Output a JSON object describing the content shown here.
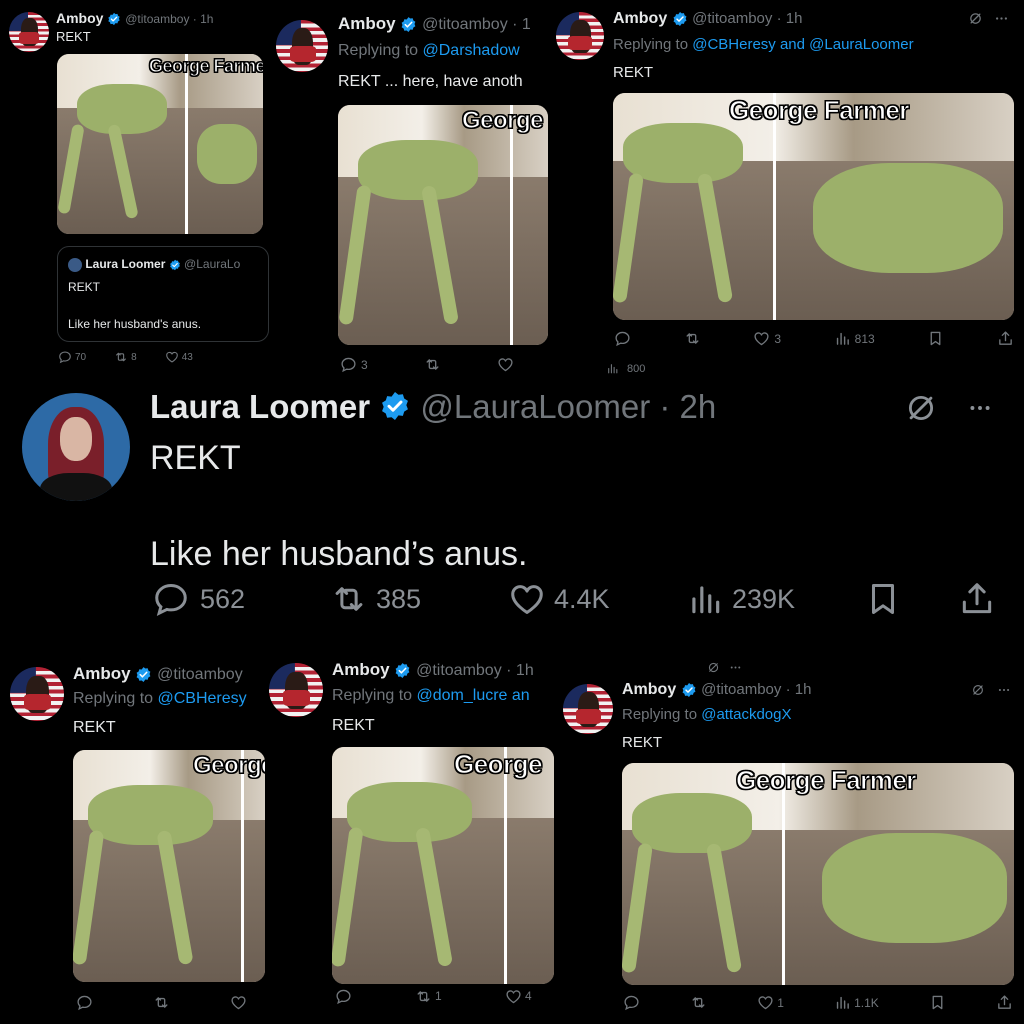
{
  "tweets_top": [
    {
      "name": "Amboy",
      "handle": "@titoamboy · 1h",
      "text": "REKT",
      "caption": "George Farmer",
      "quote": {
        "name": "Laura Loomer",
        "handle": "@LauraLo",
        "line1": "REKT",
        "line2": "Like her husband's anus."
      },
      "stats": {
        "replies": "70",
        "reposts": "8",
        "likes": "43"
      }
    },
    {
      "name": "Amboy",
      "handle": "@titoamboy · 1",
      "reply_prefix": "Replying to ",
      "reply_to": "@Darshadow",
      "text": "REKT ... here, have anoth",
      "caption": "George",
      "stats": {
        "replies": "3",
        "views": "800"
      }
    },
    {
      "name": "Amboy",
      "handle": "@titoamboy · 1h",
      "reply_prefix": "Replying to ",
      "reply_to": "@CBHeresy and @LauraLoomer",
      "text": "REKT",
      "caption": "George Farmer",
      "stats": {
        "likes": "3",
        "views": "813"
      }
    }
  ],
  "main_tweet": {
    "name": "Laura Loomer",
    "handle": "@LauraLoomer · 2h",
    "line1": "REKT",
    "line2": "Like her husband’s anus.",
    "stats": {
      "replies": "562",
      "reposts": "385",
      "likes": "4.4K",
      "views": "239K"
    }
  },
  "tweets_bottom": [
    {
      "name": "Amboy",
      "handle": "@titoamboy",
      "reply_prefix": "Replying to ",
      "reply_to": "@CBHeresy",
      "text": "REKT",
      "caption": "George"
    },
    {
      "name": "Amboy",
      "handle": "@titoamboy · 1h",
      "reply_prefix": "Replying to ",
      "reply_to": "@dom_lucre an",
      "text": "REKT",
      "caption": "George",
      "stats": {
        "reposts": "1",
        "likes": "4"
      }
    },
    {
      "name": "Amboy",
      "handle": "@titoamboy · 1h",
      "reply_prefix": "Replying to ",
      "reply_to": "@attackdogX",
      "text": "REKT",
      "caption": "George Farmer",
      "stats": {
        "likes": "1",
        "views": "1.1K"
      }
    }
  ],
  "colors": {
    "accent": "#1d9bf0",
    "muted": "#71767b",
    "text": "#e7e9ea",
    "background": "#000000"
  },
  "icons": [
    "reply-icon",
    "repost-icon",
    "like-icon",
    "views-icon",
    "bookmark-icon",
    "share-icon",
    "verified-badge-icon",
    "grok-icon",
    "more-icon"
  ]
}
